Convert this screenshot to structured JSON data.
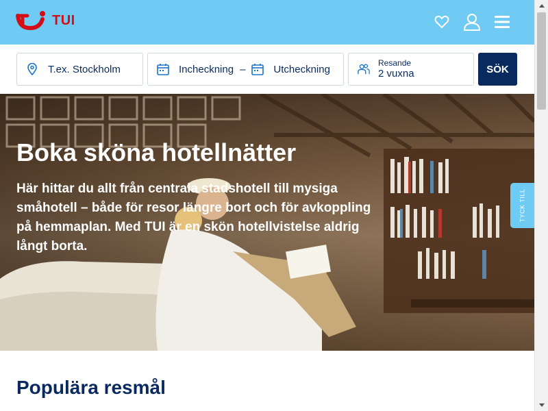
{
  "brand": {
    "name": "TUI"
  },
  "header": {
    "icons": [
      "heart-icon",
      "user-icon",
      "menu-icon"
    ]
  },
  "search": {
    "destination_placeholder": "T.ex. Stockholm",
    "checkin_label": "Incheckning",
    "separator": "–",
    "checkout_label": "Utcheckning",
    "travellers_label": "Resande",
    "travellers_value": "2 vuxna",
    "submit_label": "SÖK"
  },
  "hero": {
    "title": "Boka sköna hotellnätter",
    "text": "Här hittar du allt från centrala stadshotell till mysiga småhotell – både för resor längre bort och för avkoppling på hemmaplan. Med TUI är en skön hotellvistelse aldrig långt borta."
  },
  "feedback": {
    "label": "TYCK TILL"
  },
  "sections": {
    "popular_title": "Populära resmål"
  },
  "colors": {
    "header_bg": "#70cbf4",
    "navy": "#092a5e",
    "brand_red": "#d40e14"
  }
}
